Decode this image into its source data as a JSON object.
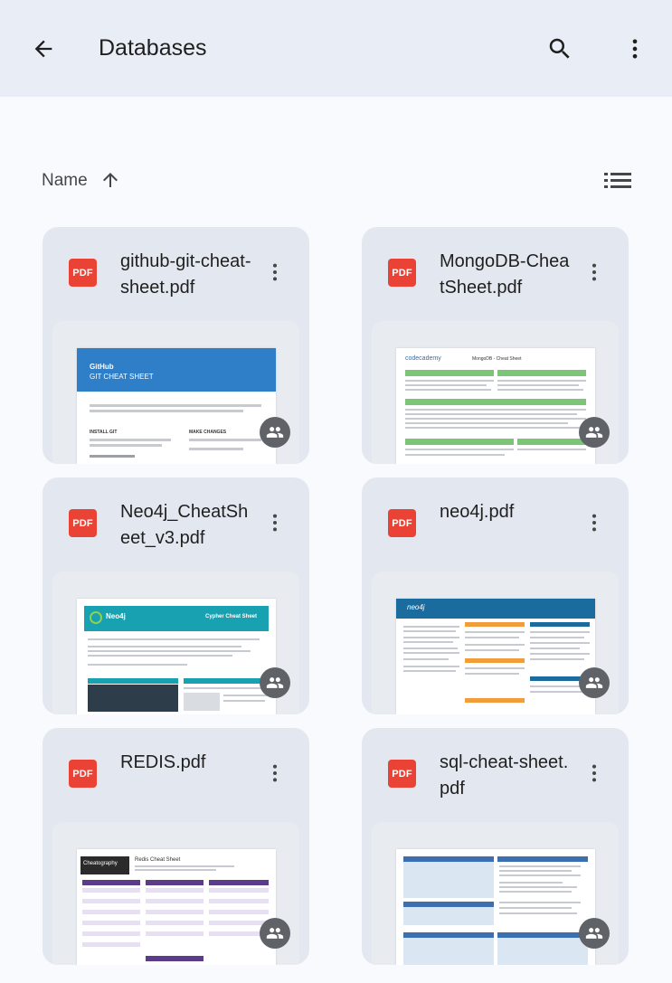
{
  "appbar": {
    "title": "Databases",
    "back_icon": "arrow-back-icon",
    "search_icon": "search-icon",
    "more_icon": "more-vert-icon"
  },
  "sort": {
    "label": "Name",
    "direction_icon": "arrow-up-icon",
    "view_toggle_icon": "list-view-icon"
  },
  "files": [
    {
      "name": "github-git-cheat-sheet.pdf",
      "type_badge": "PDF",
      "shared": true,
      "preview": "github"
    },
    {
      "name": "MongoDB-CheatSheet.pdf",
      "type_badge": "PDF",
      "shared": true,
      "preview": "mongodb"
    },
    {
      "name": "Neo4j_CheatSheet_v3.pdf",
      "type_badge": "PDF",
      "shared": true,
      "preview": "neo4j-cypher"
    },
    {
      "name": "neo4j.pdf",
      "type_badge": "PDF",
      "shared": true,
      "preview": "neo4j-refcard"
    },
    {
      "name": "REDIS.pdf",
      "type_badge": "PDF",
      "shared": true,
      "preview": "redis"
    },
    {
      "name": "sql-cheat-sheet.pdf",
      "type_badge": "PDF",
      "shared": true,
      "preview": "sql"
    }
  ],
  "preview_text": {
    "github_brand": "GitHub",
    "github_title": "GIT CHEAT SHEET",
    "github_install": "INSTALL GIT",
    "github_changes": "MAKE CHANGES",
    "mongodb_brand": "codecademy",
    "mongodb_title": "MongoDB - Cheat Sheet",
    "neo4j_brand": "Neo4j",
    "neo4j_title": "Cypher Cheat Sheet",
    "neo4j2_brand": "neo4j",
    "redis_brand": "Cheatography",
    "redis_title": "Redis Cheat Sheet"
  },
  "colors": {
    "appbar_bg": "#e9eef6",
    "page_bg": "#f8fafd",
    "card_bg": "#e3e8f0",
    "pdf_red": "#ea4335",
    "shared_badge": "#5f6368"
  }
}
